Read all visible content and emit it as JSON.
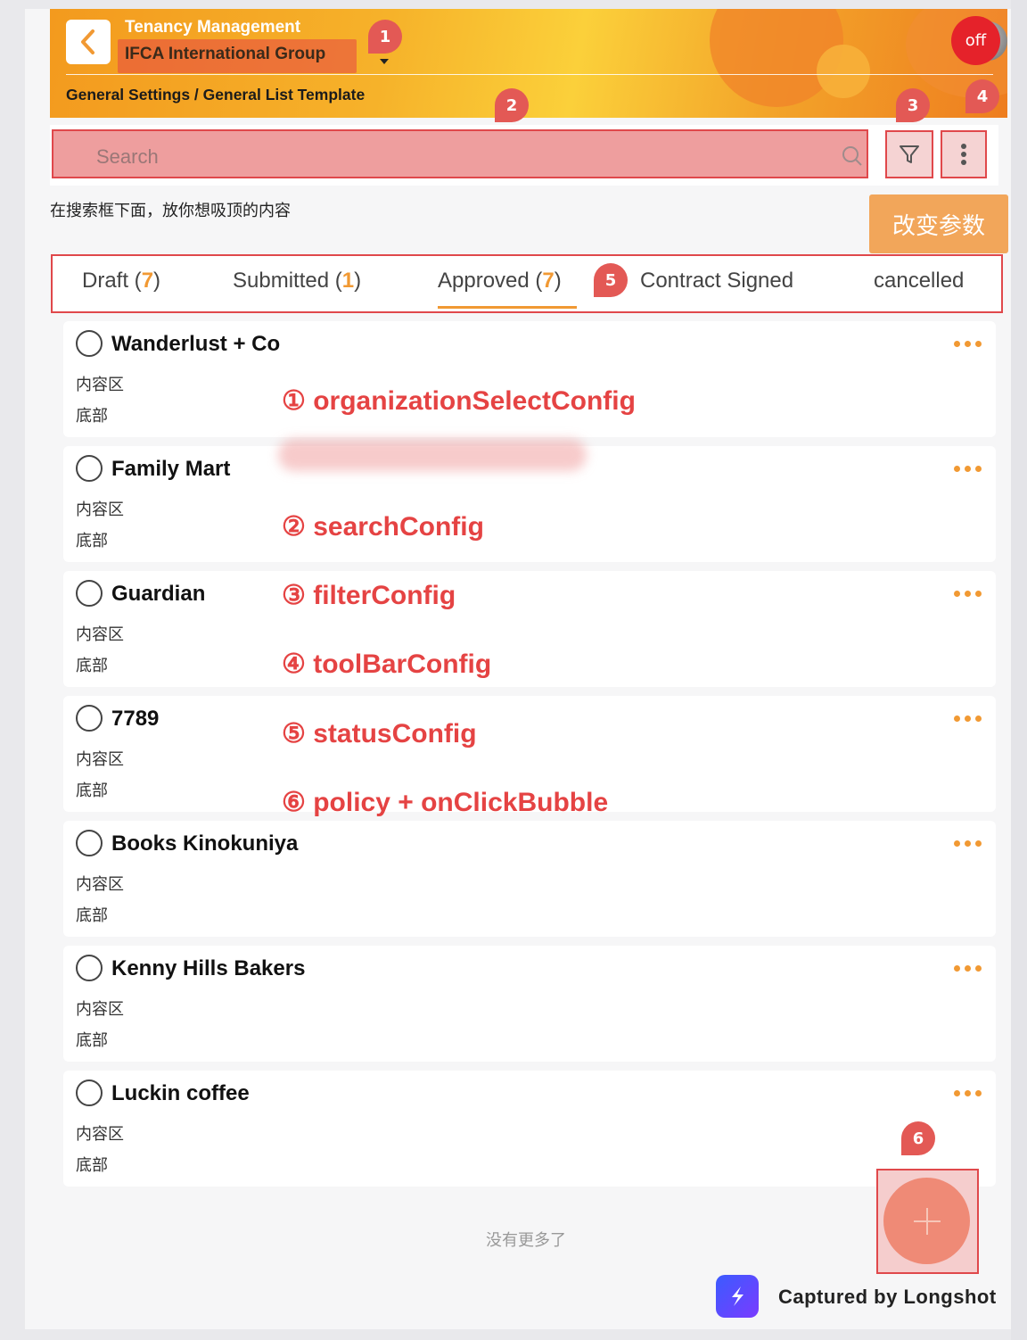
{
  "header": {
    "title": "Tenancy Management",
    "organization": "IFCA International Group",
    "breadcrumb": "General Settings / General List Template",
    "off_label": "off"
  },
  "markers": [
    "1",
    "2",
    "3",
    "4",
    "5",
    "6"
  ],
  "search": {
    "placeholder": "Search"
  },
  "sticky_note": "在搜索框下面，放你想吸顶的内容",
  "change_params_label": "改变参数",
  "tabs": [
    {
      "label": "Draft",
      "count": "7"
    },
    {
      "label": "Submitted",
      "count": "1"
    },
    {
      "label": "Approved",
      "count": "7",
      "active": true
    },
    {
      "label": "Contract Signed"
    },
    {
      "label": "cancelled"
    }
  ],
  "cards": [
    {
      "title": "Wanderlust + Co",
      "content": "内容区",
      "footer": "底部"
    },
    {
      "title": "Family Mart",
      "content": "内容区",
      "footer": "底部"
    },
    {
      "title": "Guardian",
      "content": "内容区",
      "footer": "底部"
    },
    {
      "title": "7789",
      "content": "内容区",
      "footer": "底部"
    },
    {
      "title": "Books Kinokuniya",
      "content": "内容区",
      "footer": "底部"
    },
    {
      "title": "Kenny Hills Bakers",
      "content": "内容区",
      "footer": "底部"
    },
    {
      "title": "Luckin coffee",
      "content": "内容区",
      "footer": "底部"
    }
  ],
  "annotations": [
    "① organizationSelectConfig",
    "② searchConfig",
    "③ filterConfig",
    "④ toolBarConfig",
    "⑤ statusConfig",
    "⑥ policy + onClickBubble"
  ],
  "no_more": "没有更多了",
  "watermark": "Captured by Longshot",
  "colors": {
    "accent": "#f19933",
    "highlight": "#e0484b",
    "marker": "#e35955"
  }
}
